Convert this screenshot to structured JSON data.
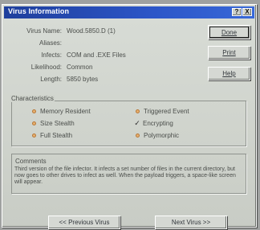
{
  "window": {
    "title": "Virus Information",
    "help_glyph": "?",
    "close_glyph": "X"
  },
  "details": {
    "name_label": "Virus Name:",
    "name_value": "Wood.5850.D (1)",
    "aliases_label": "Aliases:",
    "aliases_value": "",
    "infects_label": "Infects:",
    "infects_value": "COM and .EXE Files",
    "likelihood_label": "Likelihood:",
    "likelihood_value": "Common",
    "length_label": "Length:",
    "length_value": "5850 bytes"
  },
  "buttons": {
    "done": "Done",
    "print": "Print",
    "help": "Help",
    "previous": "<< Previous Virus",
    "next": "Next Virus >>"
  },
  "characteristics": {
    "title": "Characteristics",
    "items": [
      {
        "label": "Memory Resident",
        "state": "off"
      },
      {
        "label": "Triggered Event",
        "state": "off"
      },
      {
        "label": "Size Stealth",
        "state": "off"
      },
      {
        "label": "Encrypting",
        "state": "on"
      },
      {
        "label": "Full Stealth",
        "state": "off"
      },
      {
        "label": "Polymorphic",
        "state": "off"
      }
    ]
  },
  "comments": {
    "title": "Comments",
    "text": "Third version of the file infector. It infects a set number of files in the current directory, but now goes to other drives to infect as well. When the payload triggers, a space-like screen will appear."
  }
}
